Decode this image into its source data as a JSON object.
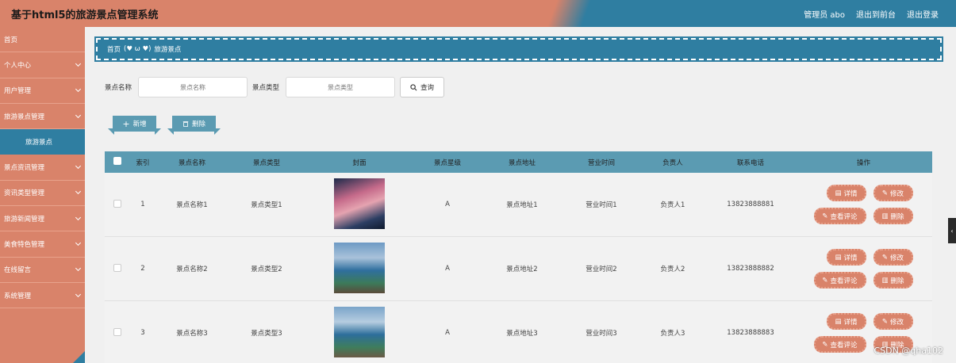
{
  "header": {
    "title": "基于html5的旅游景点管理系统",
    "admin_label": "管理员 abo",
    "exit_front": "退出到前台",
    "logout": "退出登录"
  },
  "sidebar": {
    "items": [
      {
        "label": "首页",
        "chevron": false
      },
      {
        "label": "个人中心",
        "chevron": true
      },
      {
        "label": "用户管理",
        "chevron": true
      },
      {
        "label": "旅游景点管理",
        "chevron": true
      },
      {
        "label": "旅游景点",
        "chevron": false,
        "active": true
      },
      {
        "label": "景点资讯管理",
        "chevron": true
      },
      {
        "label": "资讯类型管理",
        "chevron": true
      },
      {
        "label": "旅游新闻管理",
        "chevron": true
      },
      {
        "label": "美食特色管理",
        "chevron": true
      },
      {
        "label": "在线留言",
        "chevron": true
      },
      {
        "label": "系统管理",
        "chevron": true
      }
    ]
  },
  "breadcrumb": {
    "home": "首页",
    "emoticon": "(♥ ω ♥)",
    "current": "旅游景点"
  },
  "search": {
    "name_label": "景点名称",
    "name_placeholder": "景点名称",
    "type_label": "景点类型",
    "type_placeholder": "景点类型",
    "query_button": "查询"
  },
  "actions": {
    "add": "新增",
    "delete": "删除"
  },
  "table": {
    "headers": [
      "索引",
      "景点名称",
      "景点类型",
      "封面",
      "景点星级",
      "景点地址",
      "营业时间",
      "负责人",
      "联系电话",
      "操作"
    ],
    "rows": [
      {
        "index": "1",
        "name": "景点名称1",
        "type": "景点类型1",
        "star": "A",
        "address": "景点地址1",
        "hours": "营业时间1",
        "manager": "负责人1",
        "phone": "13823888881"
      },
      {
        "index": "2",
        "name": "景点名称2",
        "type": "景点类型2",
        "star": "A",
        "address": "景点地址2",
        "hours": "营业时间2",
        "manager": "负责人2",
        "phone": "13823888882"
      },
      {
        "index": "3",
        "name": "景点名称3",
        "type": "景点类型3",
        "star": "A",
        "address": "景点地址3",
        "hours": "营业时间3",
        "manager": "负责人3",
        "phone": "13823888883"
      }
    ],
    "row_ops": {
      "detail": "详情",
      "edit": "修改",
      "comments": "查看评论",
      "delete": "删除"
    }
  },
  "watermark": "CSDN @qha102",
  "colors": {
    "accent_orange": "#d9836a",
    "accent_blue": "#2f7ea1",
    "table_header": "#5b9bb2"
  }
}
